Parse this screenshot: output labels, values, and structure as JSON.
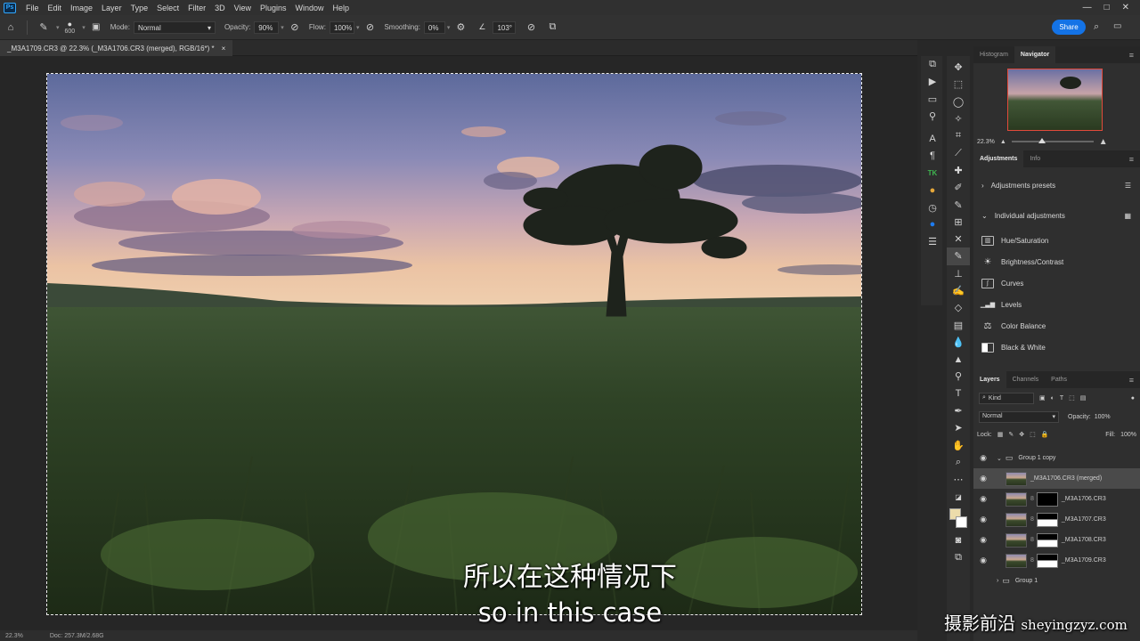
{
  "menubar": {
    "logo": "Ps",
    "items": [
      "File",
      "Edit",
      "Image",
      "Layer",
      "Type",
      "Select",
      "Filter",
      "3D",
      "View",
      "Plugins",
      "Window",
      "Help"
    ],
    "window_controls": [
      "—",
      "□",
      "✕"
    ]
  },
  "options": {
    "brush_size": "600",
    "mode_label": "Mode:",
    "mode_value": "Normal",
    "opacity_label": "Opacity:",
    "opacity_value": "90%",
    "flow_label": "Flow:",
    "flow_value": "100%",
    "smoothing_label": "Smoothing:",
    "smoothing_value": "0%",
    "angle_value": "103°",
    "share_label": "Share"
  },
  "document": {
    "tab_title": "_M3A1709.CR3 @ 22.3% (_M3A1706.CR3 (merged), RGB/16*) *",
    "close": "×",
    "zoom": "22.3%",
    "doc_info": "Doc: 257.3M/2.68G"
  },
  "navigator": {
    "tabs": [
      "Histogram",
      "Navigator"
    ],
    "active_tab": "Navigator",
    "zoom": "22.3%"
  },
  "adjustments": {
    "tabs": [
      "Adjustments",
      "Info"
    ],
    "presets_label": "Adjustments presets",
    "individual_label": "Individual adjustments",
    "items": [
      {
        "label": "Hue/Saturation",
        "icon": "hue-saturation-icon"
      },
      {
        "label": "Brightness/Contrast",
        "icon": "brightness-icon"
      },
      {
        "label": "Curves",
        "icon": "curves-icon"
      },
      {
        "label": "Levels",
        "icon": "levels-icon"
      },
      {
        "label": "Color Balance",
        "icon": "color-balance-icon"
      },
      {
        "label": "Black & White",
        "icon": "black-white-icon"
      }
    ]
  },
  "layers_panel": {
    "tabs": [
      "Layers",
      "Channels",
      "Paths"
    ],
    "filter_kind": "Kind",
    "blend_mode": "Normal",
    "opacity_label": "Opacity:",
    "opacity_value": "100%",
    "lock_label": "Lock:",
    "fill_label": "Fill:",
    "fill_value": "100%",
    "layers": [
      {
        "name": "Group 1 copy",
        "type": "group"
      },
      {
        "name": "_M3A1706.CR3 (merged)",
        "type": "pixel"
      },
      {
        "name": "_M3A1706.CR3",
        "type": "masked"
      },
      {
        "name": "_M3A1707.CR3",
        "type": "masked"
      },
      {
        "name": "_M3A1708.CR3",
        "type": "masked"
      },
      {
        "name": "_M3A1709.CR3",
        "type": "masked"
      },
      {
        "name": "Group 1",
        "type": "group"
      }
    ]
  },
  "subtitles": {
    "zh": "所以在这种情况下",
    "en": "so in this case"
  },
  "watermark": {
    "zh": "摄影前沿",
    "url": "sheyingzyz.com"
  }
}
